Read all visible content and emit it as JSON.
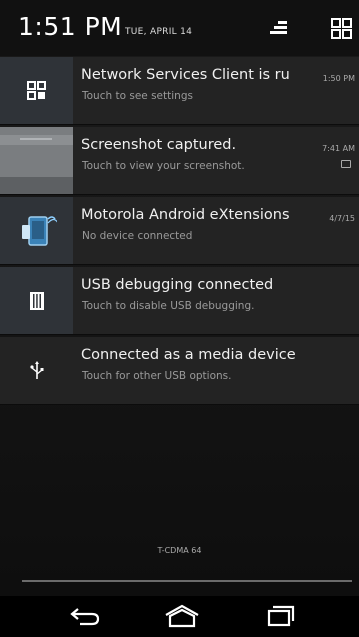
{
  "status": {
    "time": "1:51 PM",
    "date": "TUE, APRIL 14"
  },
  "header": {
    "settings_icon": "quick-settings-icon",
    "grid_icon": "grid-icon"
  },
  "notifications": [
    {
      "title": "Network Services Client is ru",
      "subtitle": "Touch to see settings",
      "time": "1:50 PM",
      "icon": "grid-app-icon"
    },
    {
      "title": "Screenshot captured.",
      "subtitle": "Touch to view your screenshot.",
      "time": "7:41 AM",
      "icon": "screenshot-thumbnail"
    },
    {
      "title": "Motorola Android eXtensions",
      "subtitle": "No device connected",
      "time": "4/7/15",
      "icon": "device-app-icon"
    },
    {
      "title": "USB debugging connected",
      "subtitle": "Touch to disable USB debugging.",
      "icon": "usb-debug-icon"
    },
    {
      "title": "Connected as a media device",
      "subtitle": "Touch for other USB options.",
      "icon": "usb-icon"
    }
  ],
  "carrier": "T-CDMA 64",
  "nav": {
    "back_icon": "back-icon",
    "home_icon": "home-icon",
    "recents_icon": "recents-icon"
  }
}
